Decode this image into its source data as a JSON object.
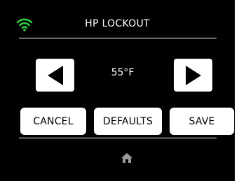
{
  "header": {
    "title": "HP LOCKOUT",
    "wifi_icon": "wifi-icon",
    "wifi_color": "#2ecc40"
  },
  "setpoint": {
    "value": "55°F",
    "decrease_icon": "left-arrow-icon",
    "increase_icon": "right-arrow-icon"
  },
  "actions": {
    "cancel_label": "CANCEL",
    "defaults_label": "DEFAULTS",
    "save_label": "SAVE"
  },
  "footer": {
    "home_icon": "home-icon",
    "home_color": "#9a9a9a"
  },
  "colors": {
    "background": "#000000",
    "button": "#ffffff",
    "text": "#ffffff"
  }
}
